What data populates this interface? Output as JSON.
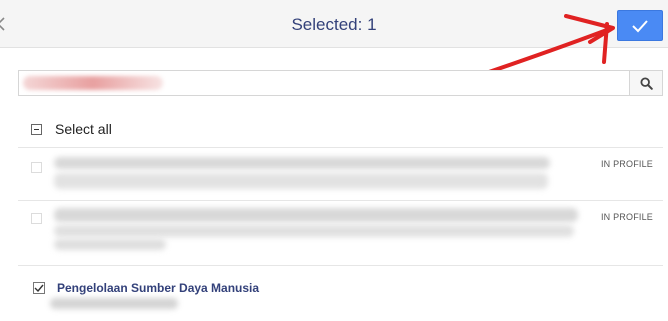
{
  "header": {
    "title": "Selected: 1",
    "back_icon": "chevron-left-icon",
    "confirm_icon": "checkmark-icon",
    "accent_color": "#4a8af4"
  },
  "search": {
    "value": "",
    "button_icon": "search-icon"
  },
  "select_all": {
    "label": "Select all",
    "state": "indeterminate"
  },
  "items": [
    {
      "name": "",
      "badge": "IN PROFILE",
      "checked": false
    },
    {
      "name": "",
      "badge": "IN PROFILE",
      "checked": false
    },
    {
      "name": "Pengelolaan Sumber Daya Manusia",
      "badge": "",
      "checked": true
    }
  ],
  "annotation": {
    "type": "arrow",
    "color": "#e02222",
    "points_to": "confirm-button"
  }
}
